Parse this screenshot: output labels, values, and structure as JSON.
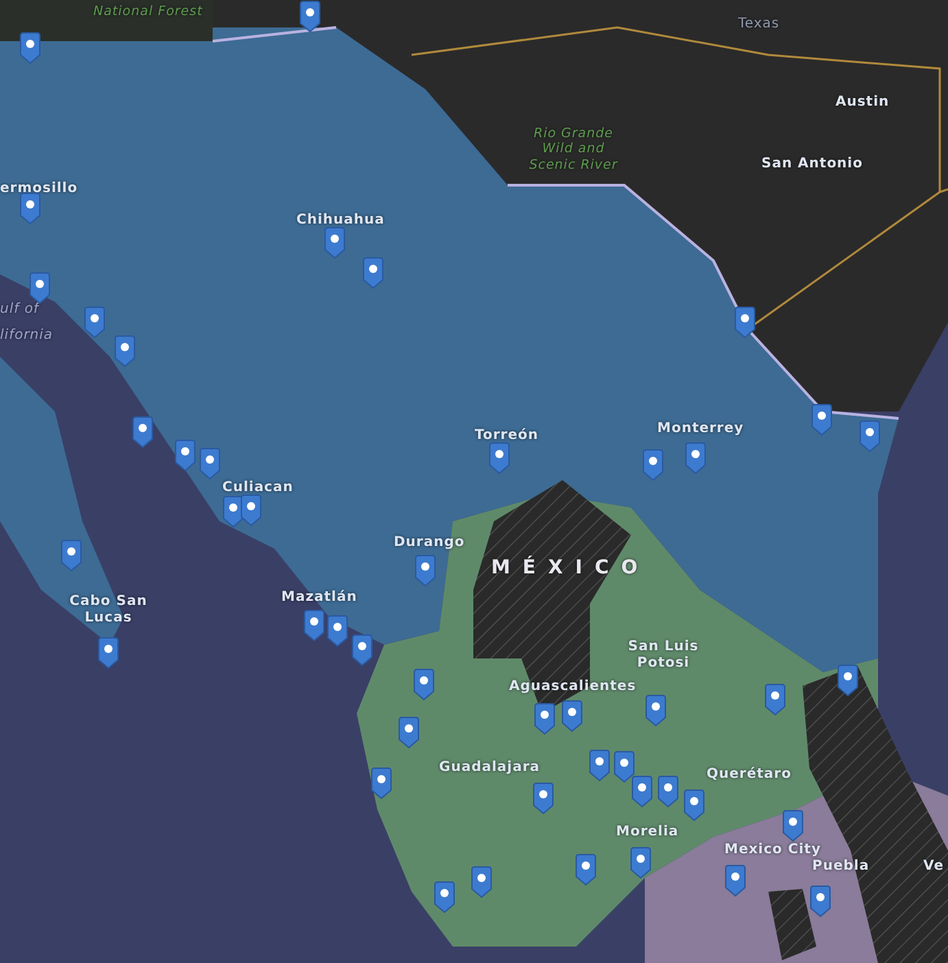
{
  "map": {
    "labels": [
      {
        "kind": "park",
        "text": "National Forest"
      },
      {
        "kind": "region",
        "text": "Texas"
      },
      {
        "kind": "city",
        "text": "Austin"
      },
      {
        "kind": "park",
        "text": "Rio Grande Wild and Scenic River"
      },
      {
        "kind": "city",
        "text": "San Antonio"
      },
      {
        "kind": "city",
        "text": "ermosillo"
      },
      {
        "kind": "city",
        "text": "Chihuahua"
      },
      {
        "kind": "water",
        "text": "ulf of"
      },
      {
        "kind": "water",
        "text": "lifornia"
      },
      {
        "kind": "city",
        "text": "Torreón"
      },
      {
        "kind": "city",
        "text": "Monterrey"
      },
      {
        "kind": "city",
        "text": "Culiacan"
      },
      {
        "kind": "city",
        "text": "Durango"
      },
      {
        "kind": "country",
        "text": "MÉXICO"
      },
      {
        "kind": "city",
        "text": "Cabo San Lucas"
      },
      {
        "kind": "city",
        "text": "Mazatlán"
      },
      {
        "kind": "city",
        "text": "San Luis Potosi"
      },
      {
        "kind": "city",
        "text": "Aguascalientes"
      },
      {
        "kind": "city",
        "text": "Guadalajara"
      },
      {
        "kind": "city",
        "text": "Querétaro"
      },
      {
        "kind": "city",
        "text": "Morelia"
      },
      {
        "kind": "city",
        "text": "Mexico City"
      },
      {
        "kind": "city",
        "text": "Puebla"
      },
      {
        "kind": "city",
        "text": "Ve"
      }
    ]
  }
}
